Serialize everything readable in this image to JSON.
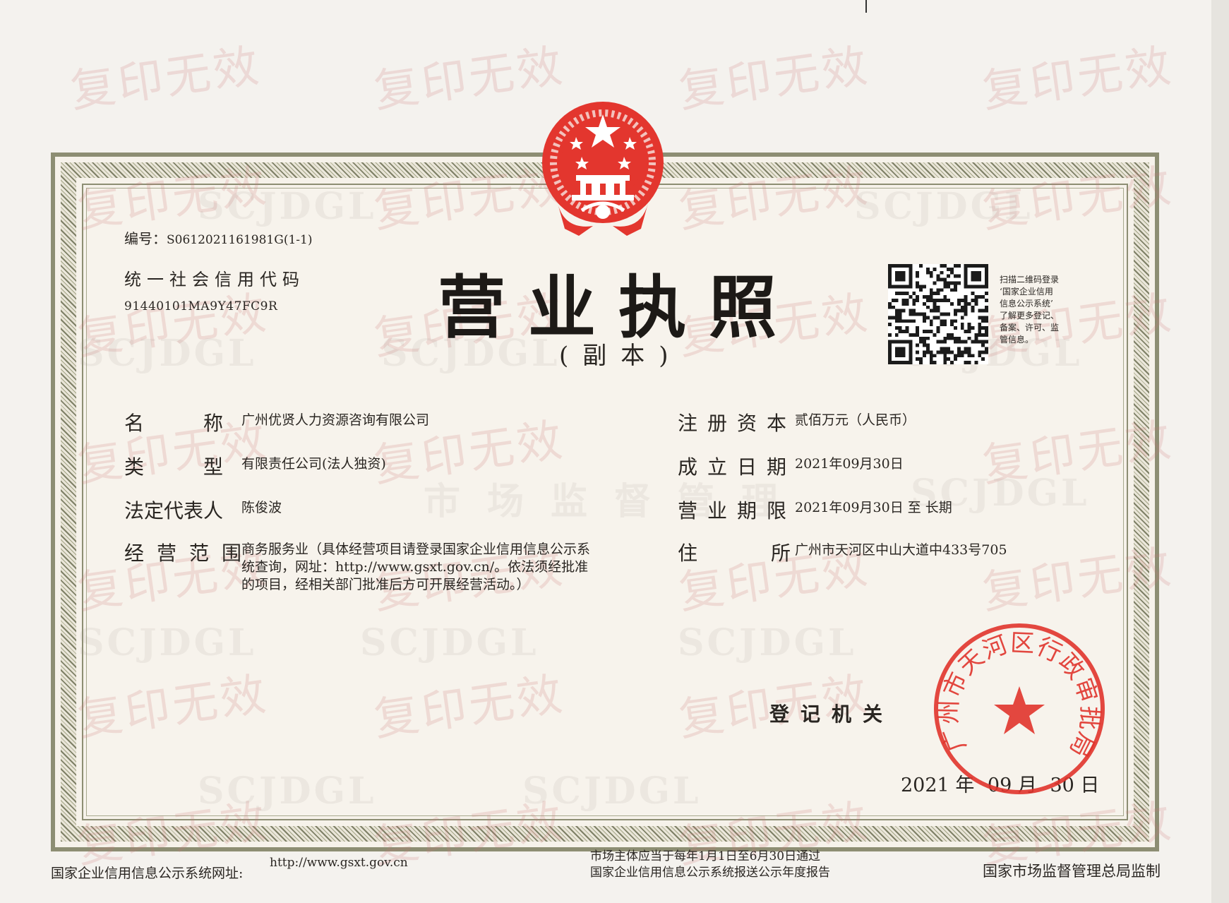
{
  "watermark": {
    "text": "复印无效",
    "code": "SCJDGL",
    "bureau": "市场监督管理"
  },
  "header": {
    "serial_label": "编号：",
    "serial_value": "S0612021161981G(1-1)",
    "uscc_label": "统一社会信用代码",
    "uscc_value": "91440101MA9Y47FC9R",
    "title": "营业执照",
    "subtitle": "(副本)"
  },
  "qr": {
    "note_lines": [
      "扫描二维码登录",
      "‘国家企业信用",
      "信息公示系统’",
      "了解更多登记、",
      "备案、许可、监",
      "管信息。"
    ]
  },
  "fields": {
    "name_label": "名　　　称",
    "name_value": "广州优贤人力资源咨询有限公司",
    "type_label": "类　　　型",
    "type_value": "有限责任公司(法人独资)",
    "rep_label": "法定代表人",
    "rep_value": "陈俊波",
    "scope_label": "经营范围",
    "scope_lines": [
      "商务服务业（具体经营项目请登录国家企业信用信息公示系",
      "统查询，网址：http://www.gsxt.gov.cn/。依法须经批准",
      "的项目，经相关部门批准后方可开展经营活动。）"
    ],
    "capital_label": "注册资本",
    "capital_value": "贰佰万元（人民币）",
    "founded_label": "成立日期",
    "founded_value": "2021年09月30日",
    "term_label": "营业期限",
    "term_value": "2021年09月30日 至 长期",
    "address_label": "住　　所",
    "address_value": "广州市天河区中山大道中433号705"
  },
  "authority": {
    "label": "登记机关",
    "date_year": "2021",
    "date_year_unit": "年",
    "date_month": "09",
    "date_month_unit": "月",
    "date_day": "30",
    "date_day_unit": "日",
    "seal_text": "广州市天河区行政审批局"
  },
  "footer": {
    "left": "国家企业信用信息公示系统网址:",
    "url": "http://www.gsxt.gov.cn",
    "mid_line1": "市场主体应当于每年1月1日至6月30日通过",
    "mid_line2": "国家企业信用信息公示系统报送公示年度报告",
    "right": "国家市场监督管理总局监制"
  },
  "colors": {
    "seal_red": "#e0342c",
    "border_olive": "#8d8e73",
    "paper": "#f6f2ea"
  }
}
